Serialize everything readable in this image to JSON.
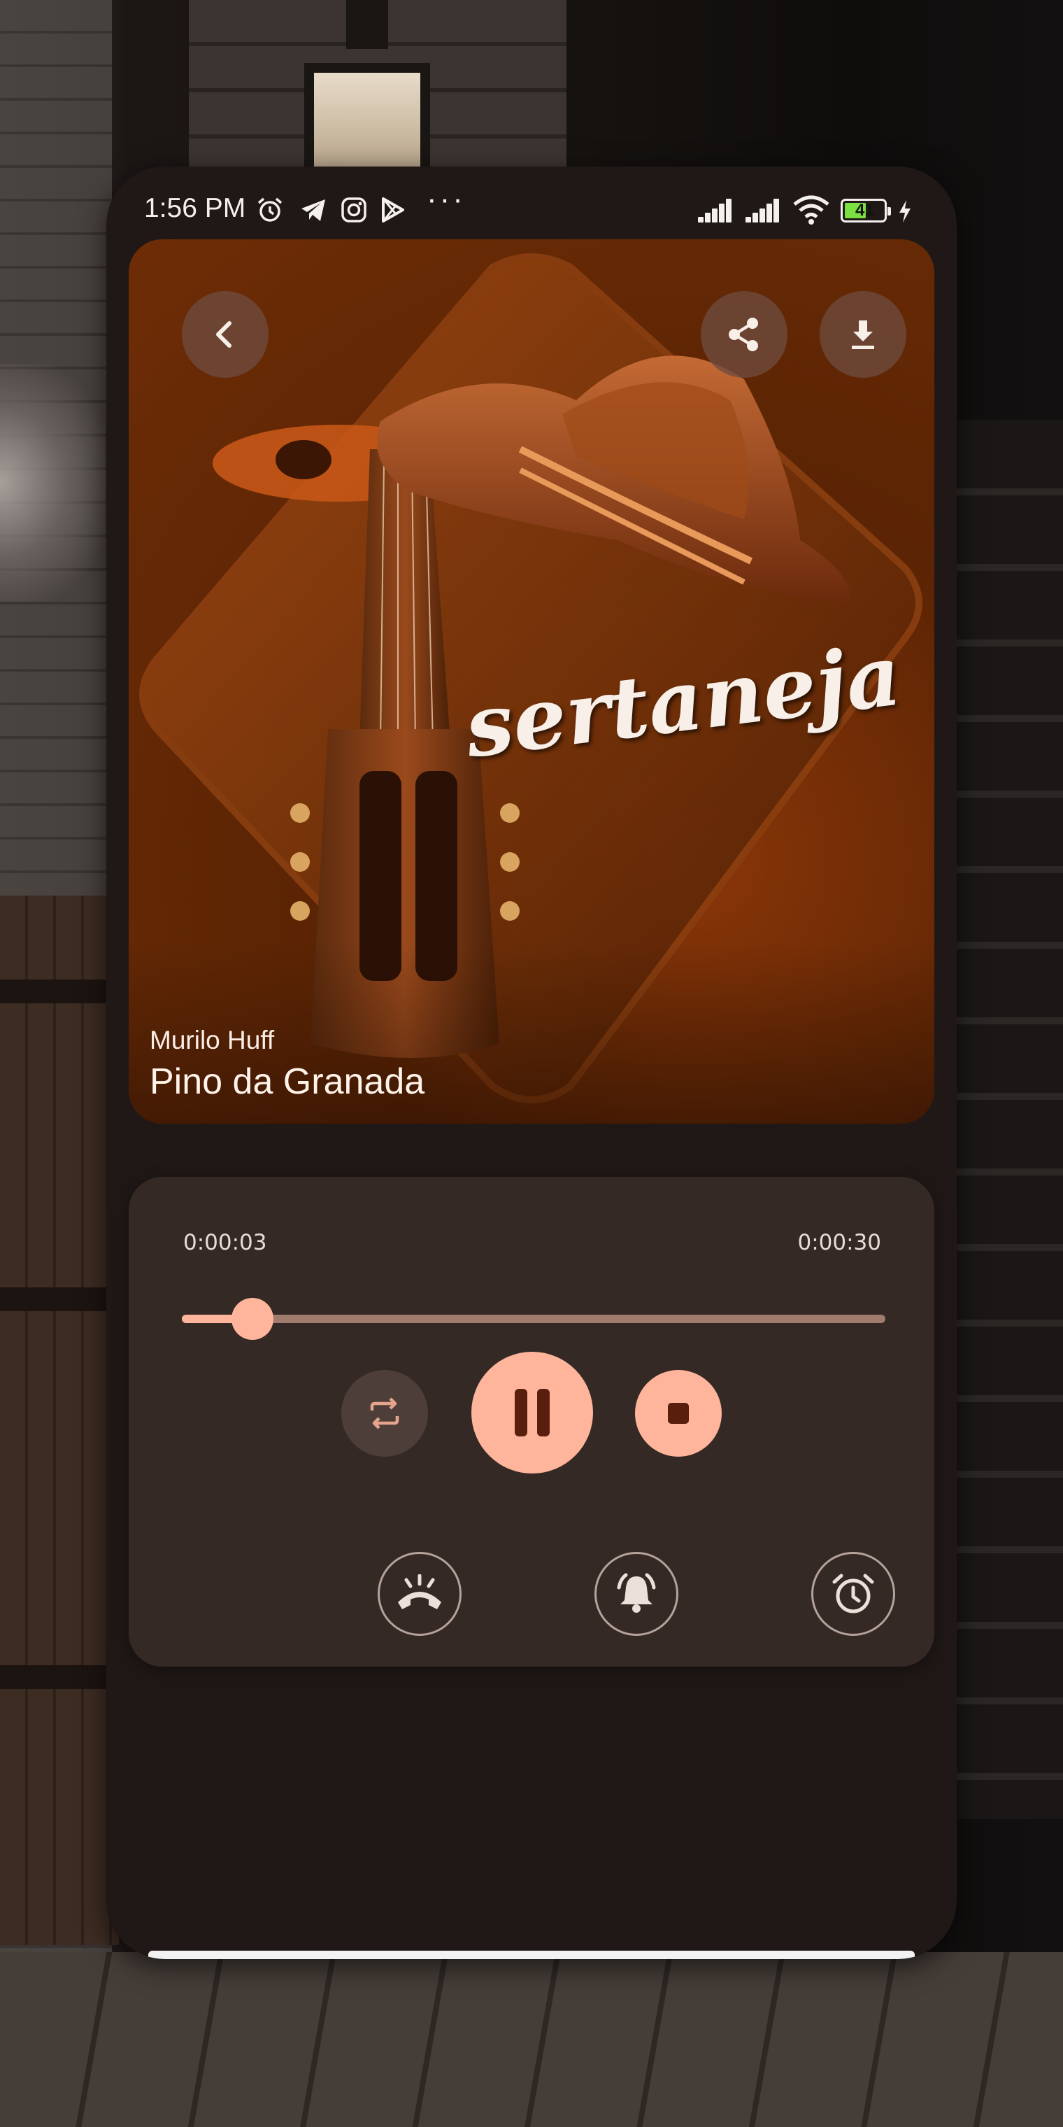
{
  "status_bar": {
    "time": "1:56 PM",
    "notification_icons": [
      "alarm-icon",
      "telegram-icon",
      "instagram-icon",
      "playstore-icon"
    ],
    "more_indicator": "···",
    "battery_level": "41",
    "system_icons": [
      "signal-icon",
      "signal-icon",
      "wifi-icon",
      "battery-icon",
      "charging-icon"
    ]
  },
  "album": {
    "artwork_text": "sertaneja",
    "artist": "Murilo Huff",
    "title": "Pino da Granada",
    "actions": [
      "back-icon",
      "share-icon",
      "download-icon"
    ]
  },
  "player": {
    "elapsed": "0:00:03",
    "total": "0:00:30",
    "progress": 0.1,
    "controls": [
      "repeat-icon",
      "pause-icon",
      "stop-icon"
    ],
    "options": [
      "ringtone-icon",
      "notification-bell-icon",
      "alarm-clock-icon"
    ]
  },
  "colors": {
    "accent": "#ffb59b",
    "card": "#352926",
    "background": "#1f1816",
    "album_base": "#6e2d06"
  }
}
